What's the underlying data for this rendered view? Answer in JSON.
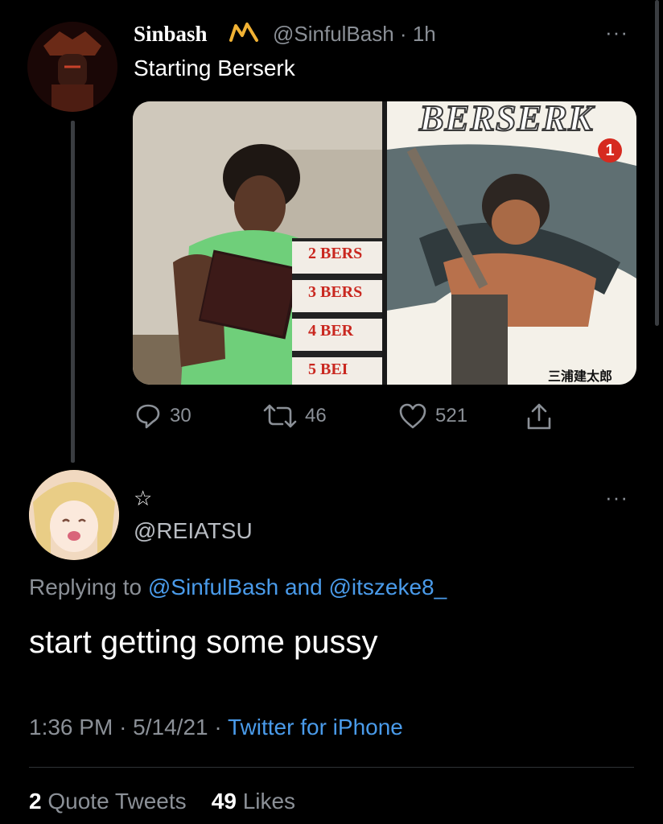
{
  "tweet": {
    "author_name": "Sinbash",
    "author_handle": "@SinfulBash",
    "time_ago": "1h",
    "separator": "·",
    "text": "Starting Berserk",
    "more_label": "···",
    "media": {
      "right_title": "BERSERK",
      "right_volume": "1",
      "right_author": "三浦建太郎",
      "book_spine_labels": [
        "2 BERS",
        "3 BERS",
        "4 BER",
        "5 BEI"
      ]
    },
    "actions": {
      "replies": "30",
      "retweets": "46",
      "likes": "521"
    }
  },
  "reply": {
    "display_name": "☆",
    "handle": "@REIATSU",
    "more_label": "···",
    "replying_prefix": "Replying to",
    "replying_to_1": "@SinfulBash",
    "replying_and": "and",
    "replying_to_2": "@itszeke8_",
    "text": "start getting some pussy",
    "time": "1:36 PM",
    "date": "5/14/21",
    "separator": "·",
    "source": "Twitter for iPhone",
    "quote_tweets_count": "2",
    "quote_tweets_label": "Quote Tweets",
    "likes_count": "49",
    "likes_label": "Likes"
  },
  "colors": {
    "background": "#000000",
    "link": "#4a9bea",
    "muted": "#8b9097",
    "text": "#ffffff"
  }
}
